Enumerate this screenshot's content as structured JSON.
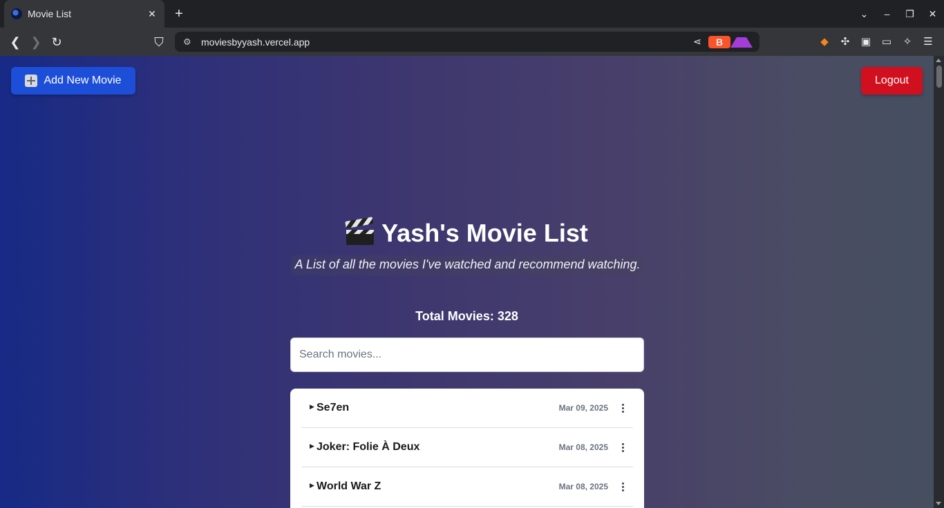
{
  "browser": {
    "tab_title": "Movie List",
    "tab_close": "✕",
    "new_tab": "+",
    "url": "moviesbyyash.vercel.app",
    "win_controls": [
      "⌄",
      "–",
      "❐",
      "✕"
    ]
  },
  "header": {
    "add_button_label": "Add New Movie",
    "logout_label": "Logout"
  },
  "hero": {
    "title": "Yash's Movie List",
    "subtitle": "A List of all the movies I've watched and recommend watching."
  },
  "stats": {
    "total_text": "Total Movies: 328"
  },
  "search": {
    "placeholder": "Search movies..."
  },
  "movies": [
    {
      "title": "Se7en",
      "date": "Mar 09, 2025"
    },
    {
      "title": "Joker: Folie À Deux",
      "date": "Mar 08, 2025"
    },
    {
      "title": "World War Z",
      "date": "Mar 08, 2025"
    }
  ],
  "colors": {
    "add_button": "#1d4ed8",
    "logout_button": "#d1101f",
    "gradient_left": "#172a85",
    "gradient_right": "#454f60"
  }
}
